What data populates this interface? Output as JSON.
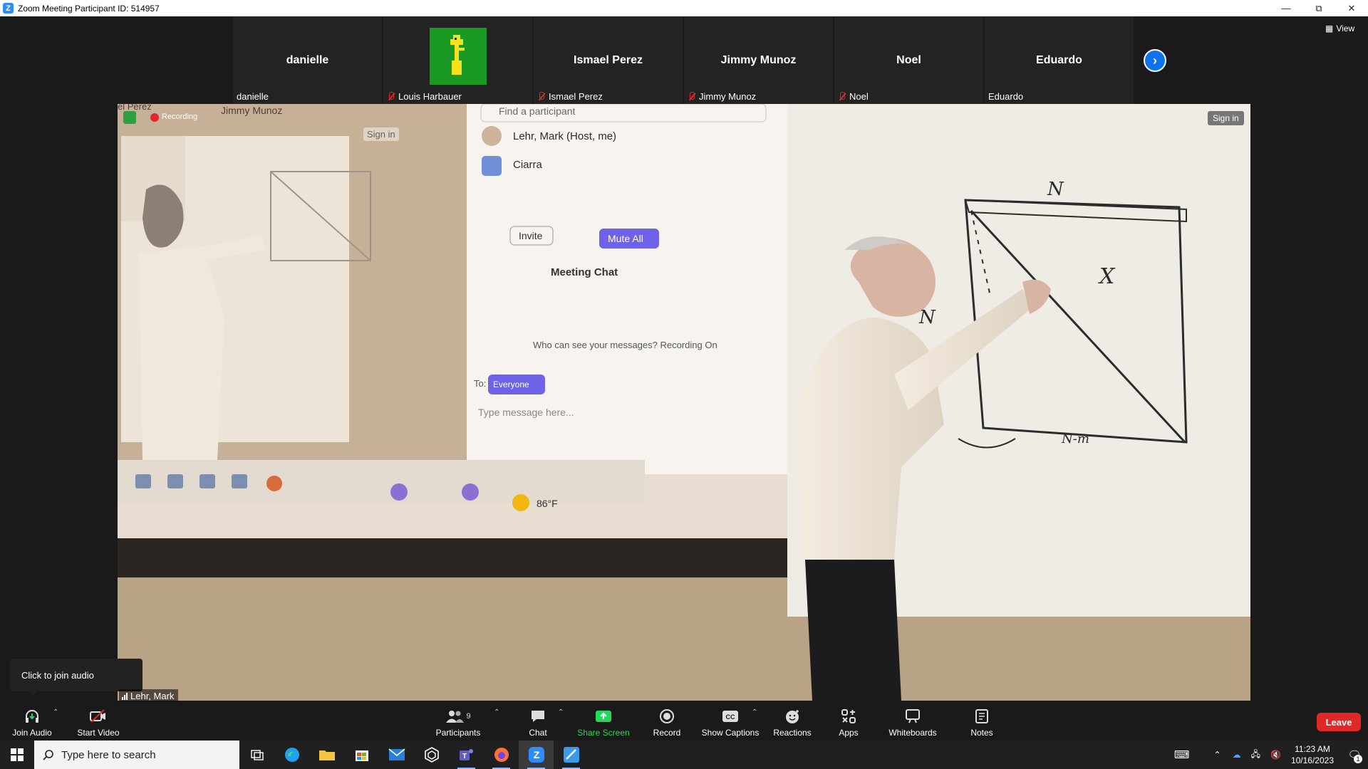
{
  "window": {
    "title": "Zoom Meeting Participant ID: 514957"
  },
  "gallery": {
    "participants": [
      {
        "big_name": "danielle",
        "label": "danielle",
        "muted": false
      },
      {
        "big_name": "",
        "label": "Louis Harbauer",
        "muted": true,
        "avatar": true
      },
      {
        "big_name": "Ismael Perez",
        "label": "Ismael Perez",
        "muted": true
      },
      {
        "big_name": "Jimmy Munoz",
        "label": "Jimmy Munoz",
        "muted": true
      },
      {
        "big_name": "Noel",
        "label": "Noel",
        "muted": true
      },
      {
        "big_name": "Eduardo",
        "label": "Eduardo",
        "muted": false
      }
    ],
    "view_label": "View"
  },
  "shared_video": {
    "sign_in_right": "Sign in",
    "inner": {
      "recording_label": "Recording",
      "top_names": [
        "el Perez",
        "Jimmy Munoz"
      ],
      "sign_in": "Sign in",
      "find_participant": "Find a participant",
      "participants": [
        "Lehr, Mark (Host, me)",
        "Ciarra"
      ],
      "invite": "Invite",
      "mute_all": "Mute All",
      "chat_title": "Meeting Chat",
      "chat_notice": "Who can see your messages? Recording On",
      "to_label": "To:",
      "to_value": "Everyone",
      "message_placeholder": "Type message here...",
      "temperature": "86°F"
    },
    "whiteboard": {
      "labels": [
        "N",
        "N",
        "X",
        "N-m"
      ]
    }
  },
  "overlay": {
    "join_tip": "Click to join audio",
    "active_speaker": "Lehr, Mark"
  },
  "toolbar": {
    "join_audio": "Join Audio",
    "start_video": "Start Video",
    "participants": "Participants",
    "participants_count": "9",
    "chat": "Chat",
    "share_screen": "Share Screen",
    "record": "Record",
    "show_captions": "Show Captions",
    "reactions": "Reactions",
    "apps": "Apps",
    "whiteboards": "Whiteboards",
    "notes": "Notes",
    "leave": "Leave"
  },
  "taskbar": {
    "search_placeholder": "Type here to search",
    "time": "11:23 AM",
    "date": "10/16/2023",
    "notification_count": "1"
  },
  "colors": {
    "zoom_blue": "#0e72ed",
    "leave_red": "#e02828",
    "share_green": "#23d959",
    "mute_all_purple": "#6e63e8"
  }
}
